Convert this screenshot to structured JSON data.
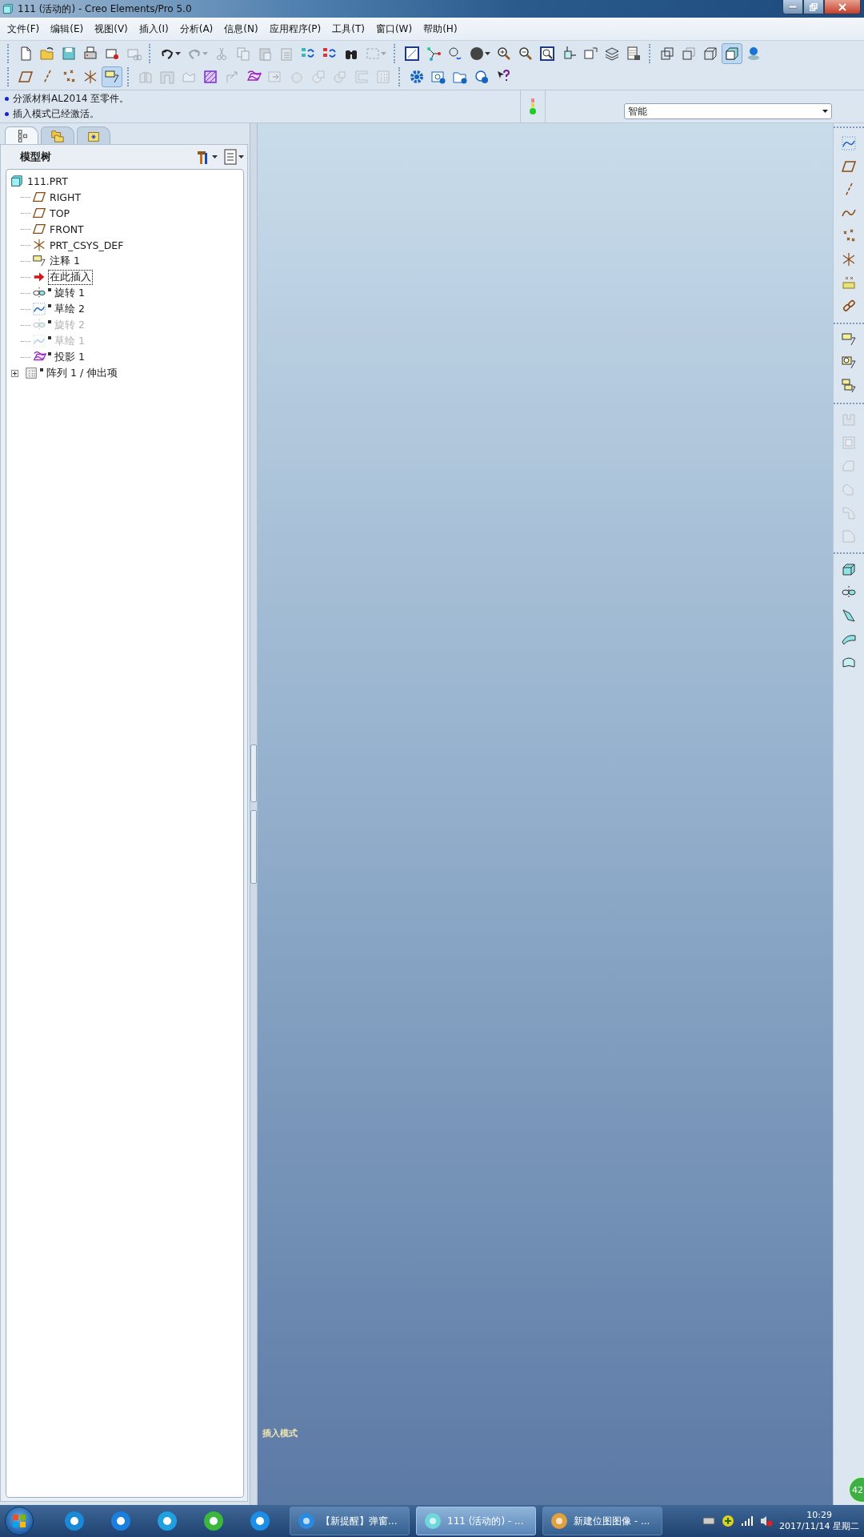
{
  "window": {
    "title": "111 (活动的) - Creo Elements/Pro 5.0"
  },
  "menu": [
    {
      "label": "文件(F)"
    },
    {
      "label": "编辑(E)"
    },
    {
      "label": "视图(V)"
    },
    {
      "label": "插入(I)"
    },
    {
      "label": "分析(A)"
    },
    {
      "label": "信息(N)"
    },
    {
      "label": "应用程序(P)"
    },
    {
      "label": "工具(T)"
    },
    {
      "label": "窗口(W)"
    },
    {
      "label": "帮助(H)"
    }
  ],
  "toolbars": [
    {
      "groups": [
        [
          {
            "kind": "new",
            "disabled": false,
            "selected": false
          },
          {
            "kind": "open",
            "disabled": false,
            "selected": false
          },
          {
            "kind": "save",
            "disabled": false,
            "selected": false
          },
          {
            "kind": "print",
            "disabled": false,
            "selected": false
          },
          {
            "kind": "mail",
            "disabled": false,
            "selected": false
          },
          {
            "kind": "maillink",
            "disabled": true,
            "selected": false
          }
        ],
        [
          {
            "kind": "undo",
            "disabled": false,
            "selected": false,
            "dropdown": true
          },
          {
            "kind": "redo",
            "disabled": true,
            "selected": false,
            "dropdown": true
          },
          {
            "kind": "cut",
            "disabled": true,
            "selected": false
          },
          {
            "kind": "copy",
            "disabled": true,
            "selected": false
          },
          {
            "kind": "paste",
            "disabled": true,
            "selected": false
          },
          {
            "kind": "pastespecial",
            "disabled": true,
            "selected": false
          },
          {
            "kind": "regen",
            "disabled": false,
            "selected": false
          },
          {
            "kind": "regenmgr",
            "disabled": false,
            "selected": false
          },
          {
            "kind": "find",
            "disabled": false,
            "selected": false
          },
          {
            "kind": "selbox",
            "disabled": true,
            "selected": false,
            "dropdown": true
          }
        ],
        [
          {
            "kind": "repaint",
            "disabled": false,
            "selected": false
          },
          {
            "kind": "spin",
            "disabled": false,
            "selected": false
          },
          {
            "kind": "orient",
            "disabled": false,
            "selected": false
          },
          {
            "kind": "sphere",
            "disabled": false,
            "selected": false,
            "dropdown": true
          },
          {
            "kind": "zoomin",
            "disabled": false,
            "selected": false
          },
          {
            "kind": "zoomout",
            "disabled": false,
            "selected": false
          },
          {
            "kind": "refit",
            "disabled": false,
            "selected": false
          },
          {
            "kind": "reorient",
            "disabled": false,
            "selected": false
          },
          {
            "kind": "viewmgr",
            "disabled": false,
            "selected": false
          },
          {
            "kind": "layers",
            "disabled": false,
            "selected": false
          },
          {
            "kind": "tablecam",
            "disabled": false,
            "selected": false
          }
        ],
        [
          {
            "kind": "wire",
            "disabled": false,
            "selected": false
          },
          {
            "kind": "hidden",
            "disabled": false,
            "selected": false
          },
          {
            "kind": "nohidden",
            "disabled": false,
            "selected": false
          },
          {
            "kind": "shaded",
            "disabled": false,
            "selected": true
          },
          {
            "kind": "appearance",
            "disabled": false,
            "selected": false
          }
        ]
      ]
    },
    {
      "groups": [
        [
          {
            "kind": "plane",
            "disabled": false,
            "selected": false
          },
          {
            "kind": "axis",
            "disabled": false,
            "selected": false
          },
          {
            "kind": "point",
            "disabled": false,
            "selected": false
          },
          {
            "kind": "csys",
            "disabled": false,
            "selected": false
          },
          {
            "kind": "note",
            "disabled": false,
            "selected": true
          }
        ],
        [
          {
            "kind": "mirror",
            "disabled": true,
            "selected": false
          },
          {
            "kind": "merge",
            "disabled": true,
            "selected": false
          },
          {
            "kind": "trim",
            "disabled": true,
            "selected": false
          },
          {
            "kind": "hatch",
            "disabled": false,
            "selected": false
          },
          {
            "kind": "offset",
            "disabled": true,
            "selected": false
          },
          {
            "kind": "project",
            "disabled": false,
            "selected": false
          },
          {
            "kind": "extend",
            "disabled": true,
            "selected": false
          },
          {
            "kind": "solidify",
            "disabled": true,
            "selected": false
          },
          {
            "kind": "intersect",
            "disabled": true,
            "selected": false
          },
          {
            "kind": "thicken",
            "disabled": true,
            "selected": false
          },
          {
            "kind": "bracket",
            "disabled": true,
            "selected": false
          },
          {
            "kind": "pattern",
            "disabled": true,
            "selected": false
          }
        ],
        [
          {
            "kind": "gear",
            "disabled": false,
            "selected": false
          },
          {
            "kind": "camcheck",
            "disabled": false,
            "selected": false
          },
          {
            "kind": "foldercheck",
            "disabled": false,
            "selected": false
          },
          {
            "kind": "circleadd",
            "disabled": false,
            "selected": false
          },
          {
            "kind": "help",
            "disabled": false,
            "selected": false
          }
        ]
      ]
    }
  ],
  "messages": [
    "分派材料AL2014 至零件。",
    "插入模式已经激活。"
  ],
  "selection_filter": {
    "value": "智能"
  },
  "navigator": {
    "tabs": [
      {
        "kind": "modeltree",
        "selected": true
      },
      {
        "kind": "folders",
        "selected": false
      },
      {
        "kind": "favorites",
        "selected": false
      }
    ],
    "title": "模型树",
    "tree": {
      "label": "111.PRT",
      "kind": "part",
      "disabled": false,
      "children": [
        {
          "label": "RIGHT",
          "kind": "plane",
          "disabled": false
        },
        {
          "label": "TOP",
          "kind": "plane",
          "disabled": false
        },
        {
          "label": "FRONT",
          "kind": "plane",
          "disabled": false
        },
        {
          "label": "PRT_CSYS_DEF",
          "kind": "csys",
          "disabled": false
        },
        {
          "label": "注释 1",
          "kind": "note",
          "disabled": false
        },
        {
          "label": "在此插入",
          "kind": "insert",
          "disabled": false
        },
        {
          "label": "旋转 1",
          "kind": "revolve",
          "disabled": false
        },
        {
          "label": "草绘 2",
          "kind": "sketch",
          "disabled": false
        },
        {
          "label": "旋转 2",
          "kind": "revolve",
          "disabled": true
        },
        {
          "label": "草绘 1",
          "kind": "sketch",
          "disabled": true
        },
        {
          "label": "投影 1",
          "kind": "project",
          "disabled": false
        },
        {
          "label": "阵列 1 / 伸出项",
          "kind": "pattern",
          "disabled": false,
          "expanded": false
        }
      ]
    }
  },
  "viewport": {
    "mode_text": "插入模式"
  },
  "right_toolbar": {
    "groups": [
      [
        {
          "kind": "sketch",
          "disabled": false
        },
        {
          "kind": "plane",
          "disabled": false
        },
        {
          "kind": "axis",
          "disabled": false
        },
        {
          "kind": "curve",
          "disabled": false
        },
        {
          "kind": "point",
          "disabled": false
        },
        {
          "kind": "csys",
          "disabled": false
        },
        {
          "kind": "analysis",
          "disabled": false
        },
        {
          "kind": "chain",
          "disabled": false
        }
      ],
      [
        {
          "kind": "note",
          "disabled": false
        },
        {
          "kind": "note2",
          "disabled": false
        },
        {
          "kind": "note3",
          "disabled": false
        }
      ],
      [
        {
          "kind": "hole",
          "disabled": true
        },
        {
          "kind": "shell",
          "disabled": true
        },
        {
          "kind": "rib",
          "disabled": true
        },
        {
          "kind": "draft",
          "disabled": true
        },
        {
          "kind": "round",
          "disabled": true
        },
        {
          "kind": "chamfer",
          "disabled": true
        }
      ],
      [
        {
          "kind": "extrude",
          "disabled": false
        },
        {
          "kind": "revolve",
          "disabled": false
        },
        {
          "kind": "sweep",
          "disabled": false
        },
        {
          "kind": "blend",
          "disabled": false
        },
        {
          "kind": "boundary",
          "disabled": false
        }
      ]
    ]
  },
  "floating_badge": {
    "text": "42"
  },
  "taskbar": {
    "pinned": [
      {
        "kind": "quick"
      },
      {
        "kind": "t"
      },
      {
        "kind": "chat"
      },
      {
        "kind": "wechat"
      },
      {
        "kind": "star"
      }
    ],
    "tasks": [
      {
        "label": "【新提醒】弹窗...",
        "kind": "browser",
        "selected": false
      },
      {
        "label": "111 (活动的) - ...",
        "kind": "creo",
        "selected": true
      },
      {
        "label": "新建位图图像 - ...",
        "kind": "paint",
        "selected": false
      }
    ],
    "clock": {
      "time": "10:29",
      "date": "2017/11/14 星期二"
    }
  }
}
